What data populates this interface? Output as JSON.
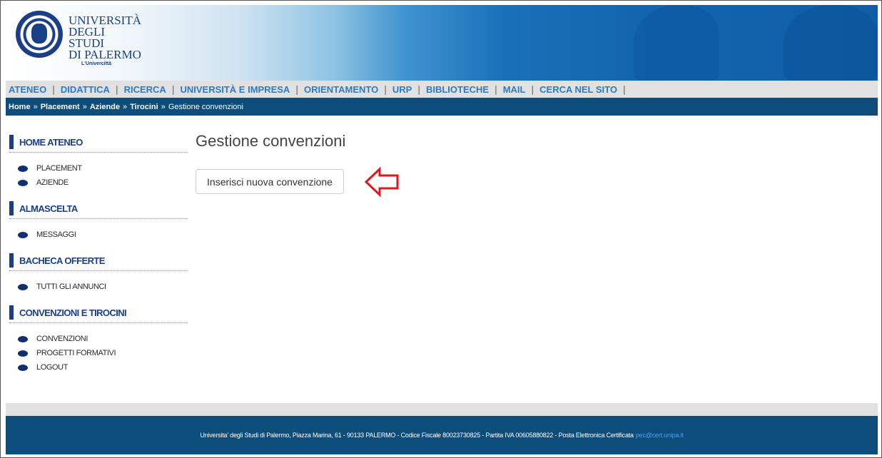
{
  "header": {
    "logo_lines": [
      "UNIVERSITÀ",
      "DEGLI STUDI",
      "DI PALERMO"
    ],
    "logo_tagline": "L'Univercittà"
  },
  "topnav": {
    "items": [
      "ATENEO",
      "DIDATTICA",
      "RICERCA",
      "UNIVERSITÀ E IMPRESA",
      "ORIENTAMENTO",
      "URP",
      "BIBLIOTECHE",
      "MAIL",
      "CERCA NEL SITO"
    ]
  },
  "breadcrumb": {
    "items": [
      "Home",
      "Placement",
      "Aziende",
      "Tirocini"
    ],
    "separator": "»",
    "current": "Gestione convenzioni"
  },
  "sidebar": {
    "sections": [
      {
        "title": "HOME ATENEO",
        "items": [
          "PLACEMENT",
          "AZIENDE"
        ]
      },
      {
        "title": "ALMASCELTA",
        "items": [
          "MESSAGGI"
        ]
      },
      {
        "title": "BACHECA OFFERTE",
        "items": [
          "TUTTI GLI ANNUNCI"
        ]
      },
      {
        "title": "CONVENZIONI E TIROCINI",
        "items": [
          "CONVENZIONI",
          "PROGETTI FORMATIVI",
          "LOGOUT"
        ]
      }
    ]
  },
  "main": {
    "title": "Gestione convenzioni",
    "new_button_label": "Inserisci nuova convenzione"
  },
  "footer": {
    "text": "Universita' degli Studi di Palermo, Piazza Marina, 61 - 90133 PALERMO - Codice Fiscale 80023730825 - Partita IVA 00605880822 - Posta Elettronica Certificata",
    "pec_link": "pec@cert.unipa.it"
  },
  "colors": {
    "nav_link": "#2a7cc7",
    "dark_blue": "#0d4d7c",
    "brand_blue": "#1a3f86",
    "arrow_red": "#e0191f"
  },
  "icons": {
    "arrow": "left-arrow-outline-icon",
    "bullet": "bullet-dot-icon",
    "seal": "university-seal-icon"
  }
}
